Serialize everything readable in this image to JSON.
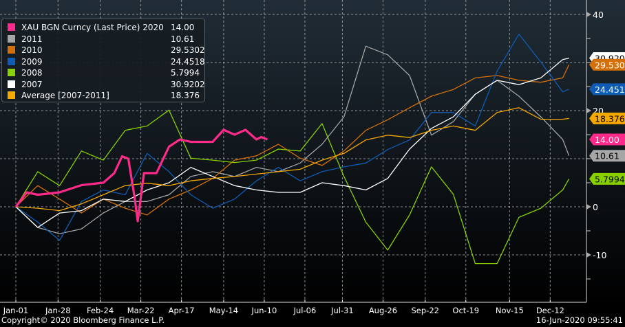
{
  "chart_data": {
    "type": "line",
    "title": "",
    "xlabel": "",
    "ylabel": "",
    "ylim": [
      -19.9,
      43
    ],
    "xlim_days": [
      0,
      365
    ],
    "grid": true,
    "legend_position": "top-left",
    "x_ticks": [
      {
        "label": "Jan-01",
        "day": 0
      },
      {
        "label": "Jan-28",
        "day": 27
      },
      {
        "label": "Feb-24",
        "day": 54
      },
      {
        "label": "Mar-22",
        "day": 80
      },
      {
        "label": "Apr-17",
        "day": 106
      },
      {
        "label": "May-14",
        "day": 133
      },
      {
        "label": "Jun-10",
        "day": 159
      },
      {
        "label": "Jul-06",
        "day": 185
      },
      {
        "label": "Jul-31",
        "day": 209
      },
      {
        "label": "Aug-26",
        "day": 235
      },
      {
        "label": "Sep-22",
        "day": 262
      },
      {
        "label": "Oct-19",
        "day": 288
      },
      {
        "label": "Nov-15",
        "day": 316
      },
      {
        "label": "Dec-12",
        "day": 342
      }
    ],
    "y_ticks": [
      40,
      30,
      20,
      10,
      0,
      -10
    ],
    "y_tick_labels": [
      "40",
      "20",
      "0",
      "-10"
    ],
    "x_days": [
      0,
      14,
      28,
      42,
      56,
      70,
      84,
      98,
      112,
      126,
      140,
      154,
      168,
      182,
      196,
      210,
      224,
      238,
      252,
      266,
      280,
      294,
      308,
      322,
      336,
      350,
      354
    ],
    "series": [
      {
        "name": "2011",
        "legend_value": "10.61",
        "color": "#a6a6a6",
        "width": 1.3,
        "values": [
          0,
          -4.3,
          -5.6,
          -4.6,
          -1.3,
          1.1,
          1.1,
          2.5,
          6.3,
          7.3,
          6.3,
          8.2,
          7.3,
          9.1,
          13,
          18.7,
          33.4,
          31.6,
          27.3,
          14.9,
          17.7,
          23.4,
          26.3,
          23,
          18.7,
          14,
          10.61
        ]
      },
      {
        "name": "2010",
        "legend_value": "29.5302",
        "color": "#d4700a",
        "width": 1.3,
        "values": [
          0,
          4.4,
          1.6,
          -1.3,
          1.6,
          -0.3,
          -1.7,
          1.6,
          3.5,
          5.9,
          9.7,
          10.6,
          13,
          10.1,
          8.6,
          11.6,
          15.9,
          18.1,
          20.6,
          23,
          24.4,
          26.8,
          27.3,
          26.3,
          25.9,
          26.8,
          29.5302
        ]
      },
      {
        "name": "2009",
        "legend_value": "24.4518",
        "color": "#0f5cb4",
        "width": 1.3,
        "values": [
          0,
          -3.2,
          -7,
          1.1,
          3.5,
          2.5,
          11.1,
          7.3,
          2.5,
          -0.3,
          1.6,
          5.4,
          8.2,
          5.4,
          7.3,
          8.3,
          9.1,
          11.9,
          13.9,
          19.6,
          19.6,
          16.8,
          28.2,
          35.9,
          30.1,
          23.9,
          24.4518
        ]
      },
      {
        "name": "2008",
        "legend_value": "5.7994",
        "color": "#88d000",
        "width": 1.3,
        "values": [
          0,
          7.3,
          4.4,
          11.6,
          9.7,
          15.9,
          16.8,
          20.1,
          10.1,
          9.7,
          9.2,
          9.7,
          12,
          11.6,
          17.3,
          6.3,
          -3.2,
          -9,
          -1.7,
          8.3,
          2.6,
          -11.8,
          -11.8,
          -2.2,
          -0.3,
          3.5,
          5.7994
        ]
      },
      {
        "name": "2007",
        "legend_value": "30.9202",
        "color": "#ffffff",
        "width": 1.3,
        "values": [
          0,
          -4.3,
          -1.3,
          -0.8,
          1.6,
          1.1,
          3.5,
          5,
          8.2,
          6.3,
          4.4,
          3.5,
          3,
          3,
          5,
          4.4,
          3.5,
          5.9,
          12,
          16.3,
          18.7,
          23.4,
          26.3,
          25.4,
          26.8,
          30.6,
          30.9202
        ]
      },
      {
        "name": "Average [2007-2011]",
        "legend_value": "18.376",
        "color": "#f5a800",
        "width": 1.3,
        "values": [
          0,
          -0.3,
          -0.8,
          0.6,
          2.5,
          4.4,
          4.9,
          4.4,
          5.4,
          5.9,
          6.3,
          6.8,
          7.3,
          7.8,
          9.7,
          11.1,
          13.9,
          14.9,
          14.4,
          15.9,
          16.8,
          15.9,
          19.6,
          20.6,
          18.2,
          18.2,
          18.376
        ]
      },
      {
        "name": "XAU BGN Curncy (Last Price) 2020",
        "legend_value": "14.00",
        "color": "#ff2a8a",
        "width": 3.2,
        "x_days": [
          0,
          7,
          14,
          28,
          42,
          56,
          63,
          68,
          72,
          76,
          78,
          82,
          90,
          98,
          105,
          112,
          126,
          133,
          140,
          147,
          154,
          157,
          161
        ],
        "values": [
          0,
          3,
          2.5,
          3,
          4.5,
          5,
          7,
          10.5,
          10,
          2,
          -3,
          7,
          7,
          12.5,
          14,
          13.5,
          13.5,
          16,
          15,
          16,
          14,
          14.5,
          14
        ]
      }
    ]
  },
  "legend": {
    "rows": [
      {
        "label": "XAU BGN Curncy (Last Price) 2020",
        "value": "14.00",
        "color": "#ff2a8a"
      },
      {
        "label": "2011",
        "value": "10.61",
        "color": "#a6a6a6"
      },
      {
        "label": "2010",
        "value": "29.5302",
        "color": "#d4700a"
      },
      {
        "label": "2009",
        "value": "24.4518",
        "color": "#0f5cb4"
      },
      {
        "label": "2008",
        "value": "5.7994",
        "color": "#88d000"
      },
      {
        "label": "2007",
        "value": "30.9202",
        "color": "#ffffff"
      },
      {
        "label": "Average [2007-2011]",
        "value": "18.376",
        "color": "#f5a800"
      }
    ]
  },
  "value_tags": [
    {
      "value": 30.9202,
      "label": "30.9202",
      "bg": "#ffffff",
      "fg": "#000000"
    },
    {
      "value": 29.5302,
      "label": "29.5302",
      "bg": "#d4700a",
      "fg": "#ffffff"
    },
    {
      "value": 24.4518,
      "label": "24.4518",
      "bg": "#0f5cb4",
      "fg": "#ffffff"
    },
    {
      "value": 18.376,
      "label": "18.376",
      "bg": "#f5a800",
      "fg": "#000000"
    },
    {
      "value": 14.0,
      "label": "14.00",
      "bg": "#ff2a8a",
      "fg": "#ffffff"
    },
    {
      "value": 10.61,
      "label": "10.61",
      "bg": "#a6a6a6",
      "fg": "#000000"
    },
    {
      "value": 5.7994,
      "label": "5.7994",
      "bg": "#88d000",
      "fg": "#000000"
    }
  ],
  "footer": {
    "copyright": "Copyright© 2020 Bloomberg Finance L.P.",
    "timestamp": "16-Jun-2020 09:55:41"
  }
}
